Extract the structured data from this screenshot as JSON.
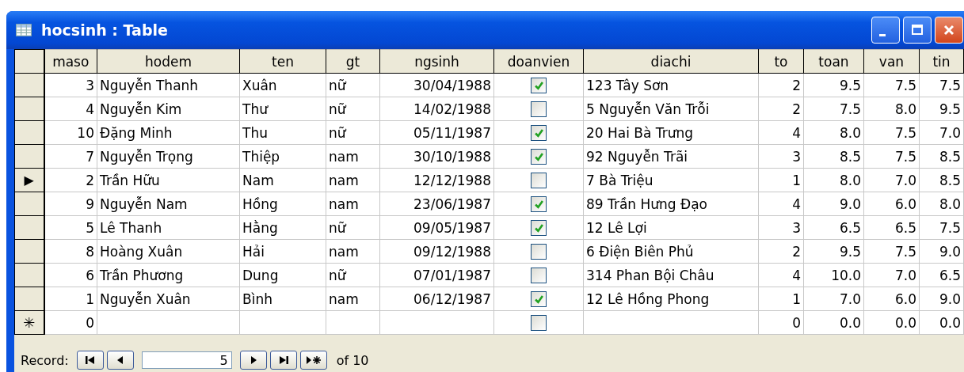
{
  "window": {
    "title": "hocsinh : Table"
  },
  "table": {
    "columns": [
      "maso",
      "hodem",
      "ten",
      "gt",
      "ngsinh",
      "doanvien",
      "diachi",
      "to",
      "toan",
      "van",
      "tin"
    ],
    "rows": [
      {
        "kind": "record",
        "marker": "",
        "maso": "3",
        "hodem": "Nguyễn Thanh",
        "ten": "Xuân",
        "gt": "nữ",
        "ngsinh": "30/04/1988",
        "doanvien": true,
        "diachi": "123 Tây Sơn",
        "to": "2",
        "toan": "9.5",
        "van": "7.5",
        "tin": "7.5"
      },
      {
        "kind": "record",
        "marker": "",
        "maso": "4",
        "hodem": "Nguyễn Kim",
        "ten": "Thư",
        "gt": "nữ",
        "ngsinh": "14/02/1988",
        "doanvien": false,
        "diachi": "5 Nguyễn Văn Trỗi",
        "to": "2",
        "toan": "7.5",
        "van": "8.0",
        "tin": "9.5"
      },
      {
        "kind": "record",
        "marker": "",
        "maso": "10",
        "hodem": "Đặng Minh",
        "ten": "Thu",
        "gt": "nữ",
        "ngsinh": "05/11/1987",
        "doanvien": true,
        "diachi": "20 Hai Bà Trưng",
        "to": "4",
        "toan": "8.0",
        "van": "7.5",
        "tin": "7.0"
      },
      {
        "kind": "record",
        "marker": "",
        "maso": "7",
        "hodem": "Nguyễn Trọng",
        "ten": "Thiệp",
        "gt": "nam",
        "ngsinh": "30/10/1988",
        "doanvien": true,
        "diachi": "92 Nguyễn Trãi",
        "to": "3",
        "toan": "8.5",
        "van": "7.5",
        "tin": "8.5"
      },
      {
        "kind": "record",
        "marker": "▶",
        "maso": "2",
        "hodem": "Trần Hữu",
        "ten": "Nam",
        "gt": "nam",
        "ngsinh": "12/12/1988",
        "doanvien": false,
        "diachi": "7 Bà Triệu",
        "to": "1",
        "toan": "8.0",
        "van": "7.0",
        "tin": "8.5"
      },
      {
        "kind": "record",
        "marker": "",
        "maso": "9",
        "hodem": "Nguyễn Nam",
        "ten": "Hồng",
        "gt": "nam",
        "ngsinh": "23/06/1987",
        "doanvien": true,
        "diachi": "89 Trần  Hưng Đạo",
        "to": "4",
        "toan": "9.0",
        "van": "6.0",
        "tin": "8.0"
      },
      {
        "kind": "record",
        "marker": "",
        "maso": "5",
        "hodem": "Lê Thanh",
        "ten": "Hằng",
        "gt": "nữ",
        "ngsinh": "09/05/1987",
        "doanvien": true,
        "diachi": "12 Lê Lợi",
        "to": "3",
        "toan": "6.5",
        "van": "6.5",
        "tin": "7.5"
      },
      {
        "kind": "record",
        "marker": "",
        "maso": "8",
        "hodem": "Hoàng Xuân",
        "ten": "Hải",
        "gt": "nam",
        "ngsinh": "09/12/1988",
        "doanvien": false,
        "diachi": "6 Điện Biên Phủ",
        "to": "2",
        "toan": "9.5",
        "van": "7.5",
        "tin": "9.0"
      },
      {
        "kind": "record",
        "marker": "",
        "maso": "6",
        "hodem": "Trần Phương",
        "ten": "Dung",
        "gt": "nữ",
        "ngsinh": "07/01/1987",
        "doanvien": false,
        "diachi": "314 Phan Bội Châu",
        "to": "4",
        "toan": "10.0",
        "van": "7.0",
        "tin": "6.5"
      },
      {
        "kind": "record",
        "marker": "",
        "maso": "1",
        "hodem": "Nguyễn Xuân",
        "ten": "Bình",
        "gt": "nam",
        "ngsinh": "06/12/1987",
        "doanvien": true,
        "diachi": "12 Lê Hồng Phong",
        "to": "1",
        "toan": "7.0",
        "van": "6.0",
        "tin": "9.0"
      },
      {
        "kind": "new",
        "marker": "✳",
        "maso": "0",
        "hodem": "",
        "ten": "",
        "gt": "",
        "ngsinh": "",
        "doanvien": false,
        "diachi": "",
        "to": "0",
        "toan": "0.0",
        "van": "0.0",
        "tin": "0.0"
      }
    ]
  },
  "navigator": {
    "label": "Record:",
    "current": "5",
    "total": "of 10"
  }
}
